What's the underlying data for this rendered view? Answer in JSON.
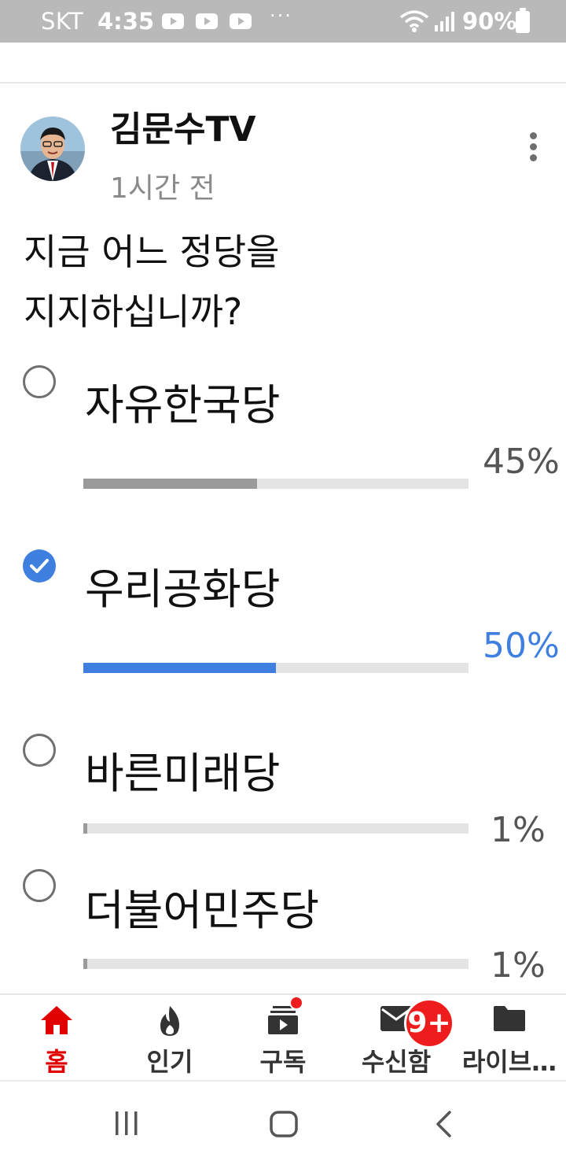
{
  "status_bar": {
    "carrier": "SKT",
    "time": "4:35",
    "more": "···",
    "battery": "90%",
    "icons": [
      "youtube-icon",
      "youtube-icon",
      "youtube-icon",
      "wifi-icon",
      "signal-icon",
      "battery-icon"
    ]
  },
  "post": {
    "channel": "김문수TV",
    "time": "1시간 전",
    "question_line1": "지금 어느 정당을",
    "question_line2": "지지하십니까?",
    "options": [
      {
        "label": "자유한국당",
        "percent_text": "45%",
        "percent": 45,
        "selected": false
      },
      {
        "label": "우리공화당",
        "percent_text": "50%",
        "percent": 50,
        "selected": true
      },
      {
        "label": "바른미래당",
        "percent_text": "1%",
        "percent": 1,
        "selected": false
      },
      {
        "label": "더불어민주당",
        "percent_text": "1%",
        "percent": 1,
        "selected": false
      }
    ]
  },
  "bottom_nav": {
    "items": [
      {
        "label": "홈",
        "icon": "home-icon",
        "active": true
      },
      {
        "label": "인기",
        "icon": "flame-icon",
        "active": false
      },
      {
        "label": "구독",
        "icon": "subscriptions-icon",
        "active": false
      },
      {
        "label": "수신함",
        "icon": "mail-icon",
        "active": false
      },
      {
        "label": "라이브…",
        "icon": "folder-icon",
        "active": false
      }
    ],
    "inbox_badge": "9+"
  },
  "colors": {
    "accent_blue": "#3e7fe0",
    "youtube_red": "#e00000",
    "badge_red": "#ee1c1c",
    "status_bar_bg": "#b9b9b9"
  }
}
